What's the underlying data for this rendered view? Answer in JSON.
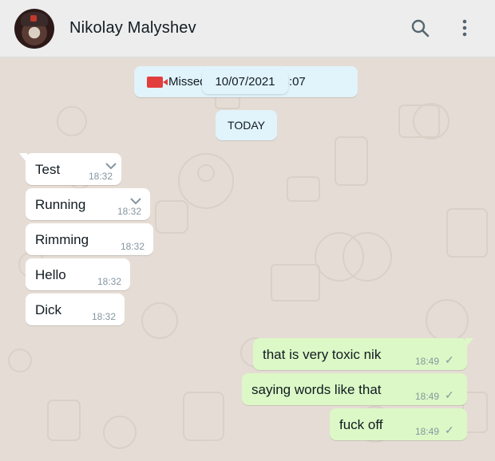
{
  "header": {
    "contact_name": "Nikolay Malyshev",
    "icons": [
      "search-icon",
      "more-vertical-icon"
    ]
  },
  "system": {
    "missed_call_text": "Missed voice call at 18:07",
    "date_chip": "10/07/2021",
    "today_label": "TODAY"
  },
  "messages_in": [
    {
      "text": "Test",
      "time": "18:32"
    },
    {
      "text": "Running",
      "time": "18:32"
    },
    {
      "text": "Rimming",
      "time": "18:32"
    },
    {
      "text": "Hello",
      "time": "18:32"
    },
    {
      "text": "Dick",
      "time": "18:32"
    }
  ],
  "messages_out": [
    {
      "text": "that is very toxic nik",
      "time": "18:49"
    },
    {
      "text": "saying words like that",
      "time": "18:49"
    },
    {
      "text": "fuck off",
      "time": "18:49"
    }
  ],
  "colors": {
    "wallpaper": "#e5ddd5",
    "incoming": "#ffffff",
    "outgoing": "#dcf8c6",
    "system": "#e1f3fb",
    "missed_call_red": "#e23e3e"
  }
}
